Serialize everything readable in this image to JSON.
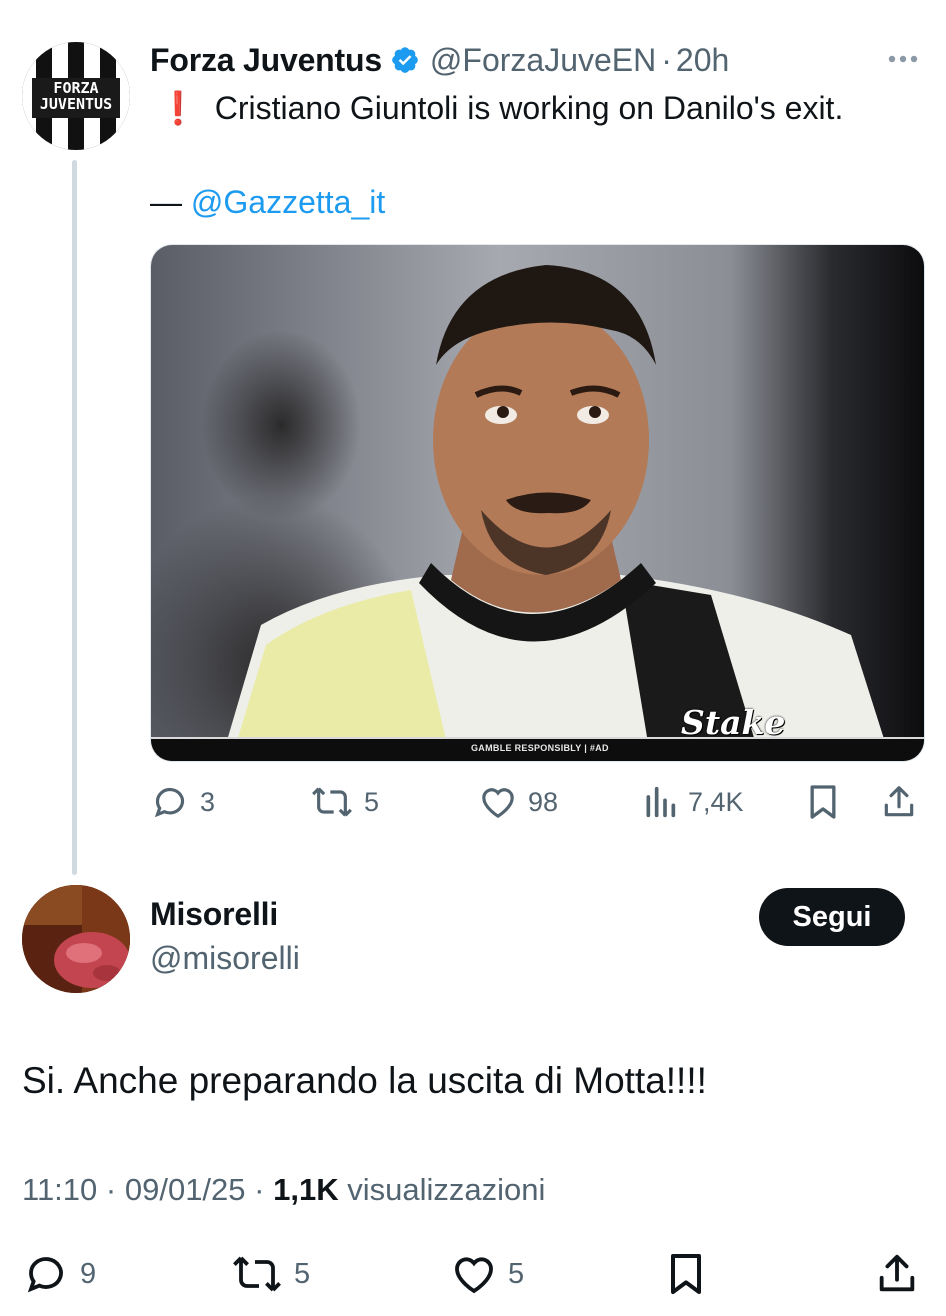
{
  "original_tweet": {
    "avatar_text": [
      "FORZA",
      "JUVENTUS"
    ],
    "author_name": "Forza Juventus",
    "verified": true,
    "handle": "@ForzaJuveEN",
    "separator": "·",
    "time_ago": "20h",
    "alert_icon": "❗",
    "text": "Cristiano Giuntoli is working on Danilo's exit.",
    "quote_dash": "—",
    "quote_source": "@Gazzetta_it",
    "media": {
      "watermark": "Stake",
      "disclaimer": "GAMBLE RESPONSIBLY | #AD"
    },
    "stats": {
      "replies": "3",
      "retweets": "5",
      "likes": "98",
      "views": "7,4K"
    }
  },
  "reply": {
    "author_name": "Misorelli",
    "handle": "@misorelli",
    "follow_label": "Segui",
    "text": "Si. Anche preparando la uscita di Motta!!!!",
    "time": "11:10",
    "date": "09/01/25",
    "separator": "·",
    "views": "1,1K",
    "views_label": "visualizzazioni",
    "stats": {
      "replies": "9",
      "retweets": "5",
      "likes": "5"
    }
  },
  "colors": {
    "accent": "#1d9bf0",
    "text": "#0f1419",
    "secondary": "#536471",
    "alert": "#e0245e"
  }
}
